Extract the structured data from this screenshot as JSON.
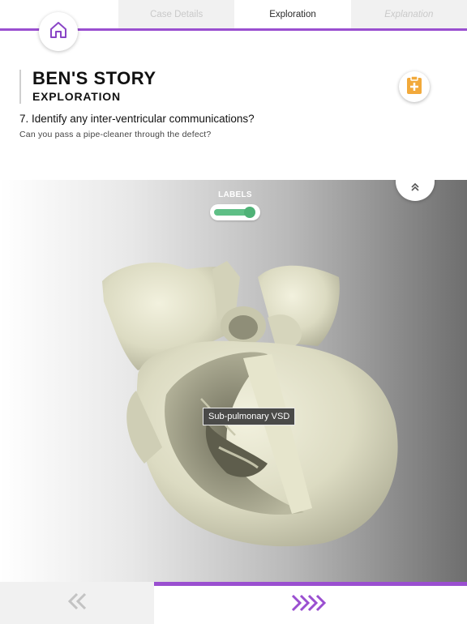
{
  "tabs": [
    {
      "label": "Case Details",
      "state": "inactive"
    },
    {
      "label": "Exploration",
      "state": "active"
    },
    {
      "label": "Explanation",
      "state": "inactive"
    }
  ],
  "header": {
    "title": "BEN'S STORY",
    "subtitle": "EXPLORATION"
  },
  "question": {
    "text": "7. Identify any inter-ventricular communications?",
    "hint": "Can you pass a pipe-cleaner through the defect?"
  },
  "viewer": {
    "labels_toggle_title": "LABELS",
    "labels_enabled": true,
    "annotation": "Sub-pulmonary VSD"
  },
  "icons": {
    "home": "home-icon",
    "clipboard": "clipboard-plus-icon",
    "collapse": "chevron-double-up-icon",
    "prev": "chevron-double-left-icon",
    "next": "chevron-quad-right-icon"
  },
  "colors": {
    "accent": "#9a4fd0",
    "toggle_on": "#5fbf86",
    "clipboard": "#f2a93b"
  }
}
